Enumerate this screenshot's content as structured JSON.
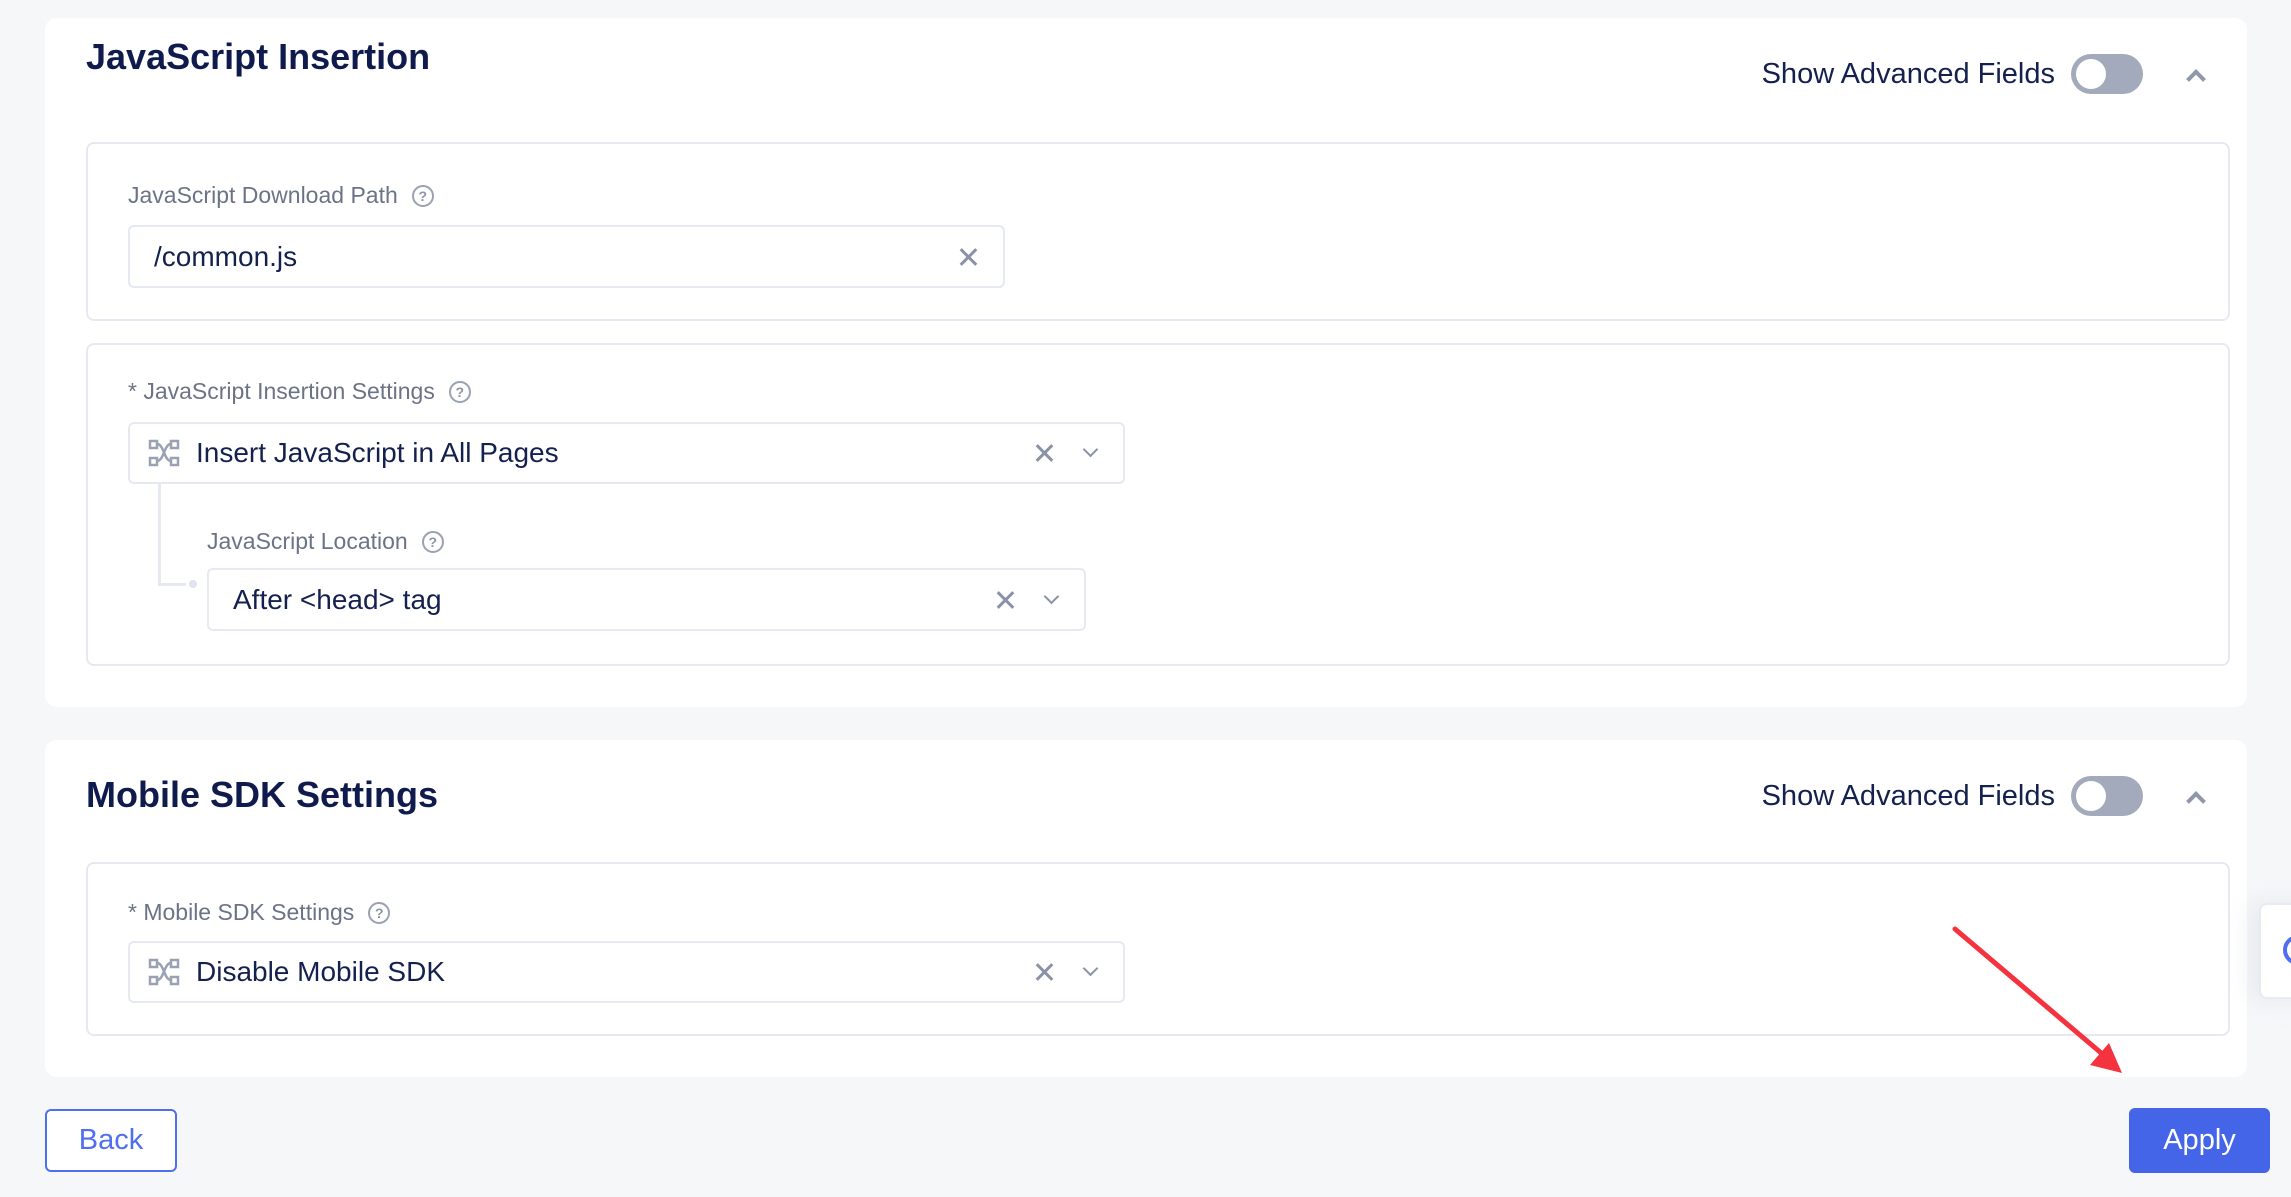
{
  "sections": {
    "js_insertion": {
      "title": "JavaScript Insertion",
      "advanced_label": "Show Advanced Fields",
      "advanced_enabled": false,
      "download_path": {
        "label": "JavaScript Download Path",
        "value": "/common.js"
      },
      "insertion_settings": {
        "label": "* JavaScript Insertion Settings",
        "value": "Insert JavaScript in All Pages"
      },
      "location": {
        "label": "JavaScript Location",
        "value": "After <head> tag"
      }
    },
    "mobile_sdk": {
      "title": "Mobile SDK Settings",
      "advanced_label": "Show Advanced Fields",
      "advanced_enabled": false,
      "sdk_settings": {
        "label": "* Mobile SDK Settings",
        "value": "Disable Mobile SDK"
      }
    }
  },
  "footer": {
    "back_label": "Back",
    "apply_label": "Apply"
  },
  "icons": {
    "help": "?",
    "annotation_color": "#f5333f",
    "primary_color": "#4565e8"
  }
}
